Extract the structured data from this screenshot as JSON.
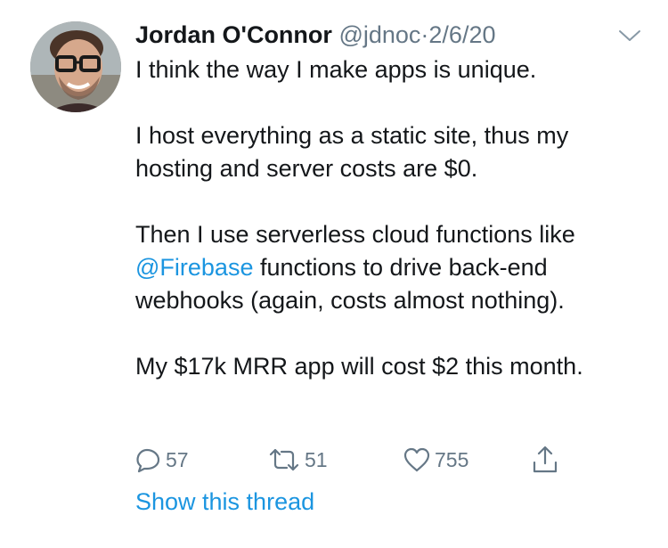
{
  "tweet": {
    "author_name": "Jordan O'Connor",
    "handle": "@jdnoc",
    "separator": "·",
    "date": "2/6/20",
    "paragraphs": [
      {
        "segments": [
          {
            "text": "I think the way I make apps is unique.",
            "type": "text"
          }
        ]
      },
      {
        "segments": [
          {
            "text": "I host everything as a static site, thus my hosting and server costs are $0.",
            "type": "text"
          }
        ]
      },
      {
        "segments": [
          {
            "text": "Then I use serverless cloud functions like ",
            "type": "text"
          },
          {
            "text": "@Firebase",
            "type": "mention"
          },
          {
            "text": " functions to drive back-end webhooks (again, costs almost nothing).",
            "type": "text"
          }
        ]
      },
      {
        "segments": [
          {
            "text": "My $17k MRR app will cost $2 this month.",
            "type": "text"
          }
        ]
      }
    ],
    "actions": {
      "reply_count": "57",
      "retweet_count": "51",
      "like_count": "755"
    },
    "show_thread_label": "Show this thread",
    "icons": {
      "more": "chevron-down-icon",
      "reply": "reply-icon",
      "retweet": "retweet-icon",
      "like": "heart-icon",
      "share": "share-icon"
    }
  },
  "colors": {
    "text": "#14171a",
    "secondary": "#657786",
    "link": "#1b95e0",
    "background": "#ffffff"
  }
}
